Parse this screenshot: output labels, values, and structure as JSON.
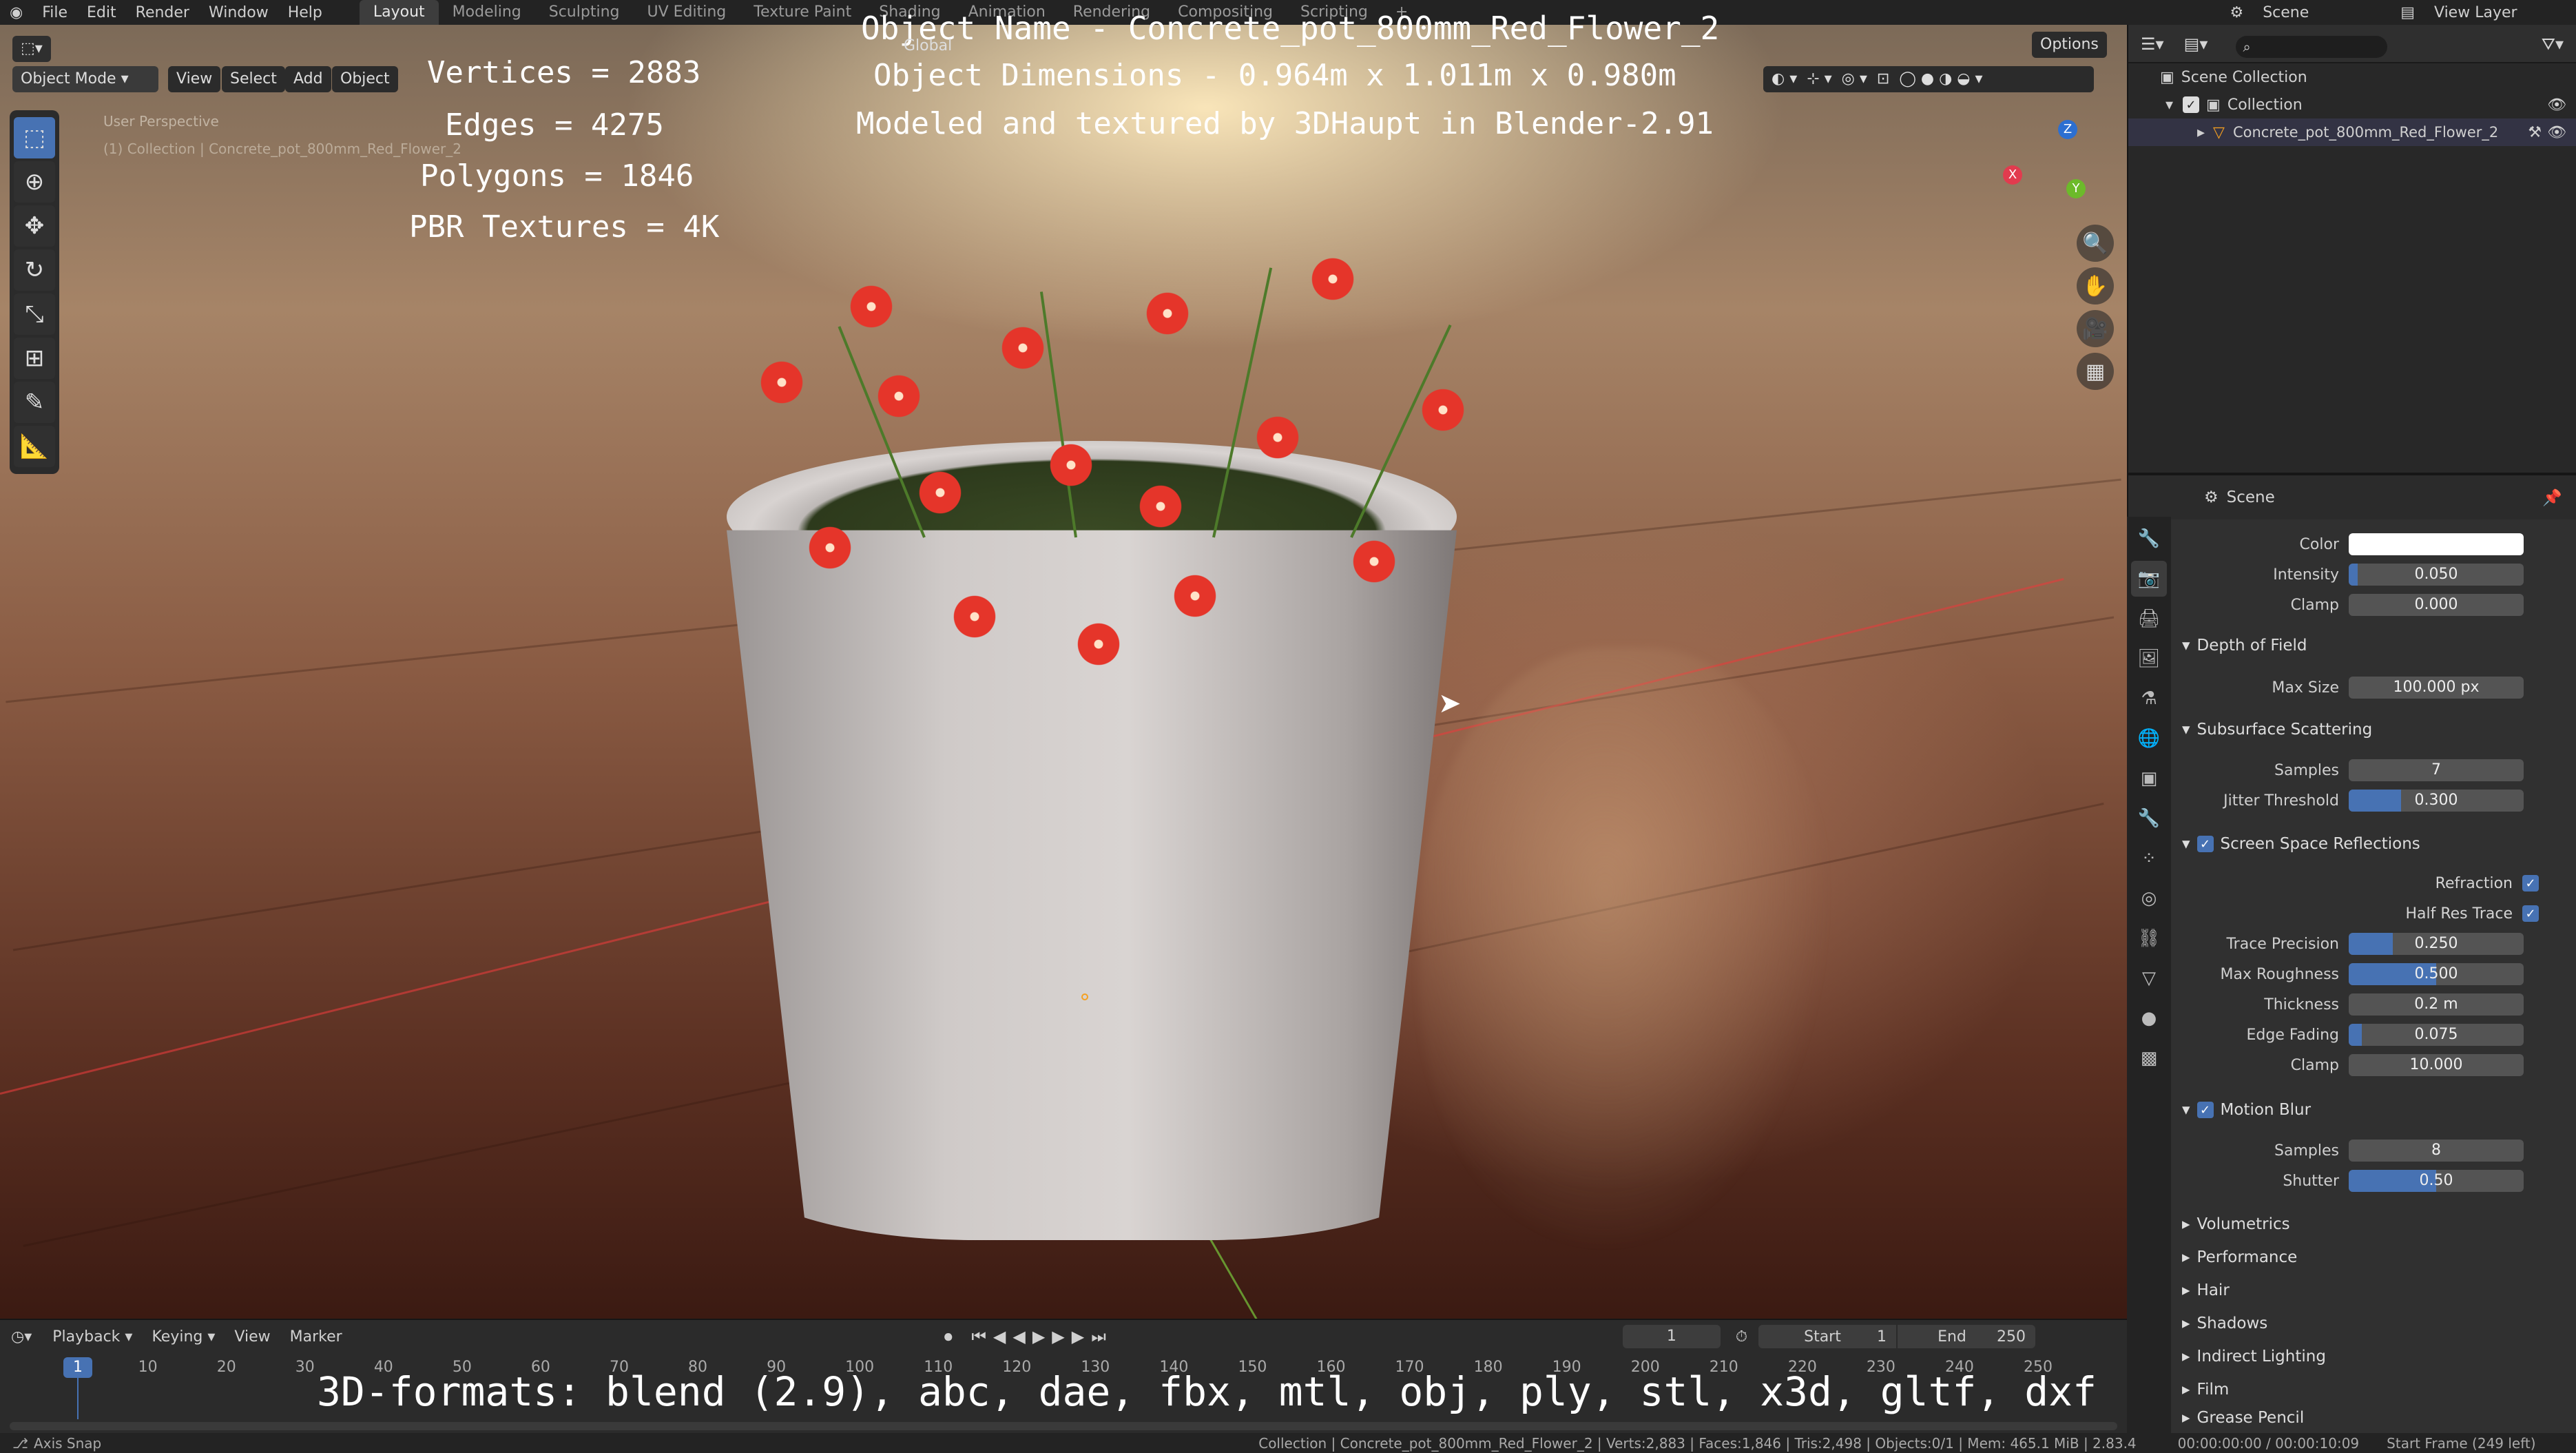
{
  "menu": {
    "items": [
      "File",
      "Edit",
      "Render",
      "Window",
      "Help"
    ]
  },
  "workspaces": [
    "Layout",
    "Modeling",
    "Sculpting",
    "UV Editing",
    "Texture Paint",
    "Shading",
    "Animation",
    "Rendering",
    "Compositing",
    "Scripting"
  ],
  "top_right": {
    "scene": "Scene",
    "view_layer": "View Layer"
  },
  "viewport_header": {
    "mode": "Object Mode",
    "view": "View",
    "select": "Select",
    "add": "Add",
    "object": "Object",
    "orientation": "Global",
    "options": "Options"
  },
  "viewport_info": {
    "perspective": "User Perspective",
    "collection": "(1) Collection | Concrete_pot_800mm_Red_Flower_2"
  },
  "overlay": {
    "object_name": "Object Name - Concrete_pot_800mm_Red_Flower_2",
    "dimensions": "Object Dimensions -  0.964m x 1.011m x 0.980m",
    "credit": "Modeled and textured by 3DHaupt in Blender-2.91",
    "vertices": "Vertices = 2883",
    "edges": "Edges = 4275",
    "polygons": "Polygons = 1846",
    "textures": "PBR Textures = 4K",
    "formats": "3D-formats: blend (2.9), abc, dae, fbx, mtl, obj, ply, stl, x3d, gltf, dxf"
  },
  "outliner": {
    "root": "Scene Collection",
    "collection": "Collection",
    "object": "Concrete_pot_800mm_Red_Flower_2"
  },
  "properties": {
    "context": "Scene",
    "color_label": "Color",
    "intensity": {
      "label": "Intensity",
      "value": "0.050",
      "fill": 0.05
    },
    "clamp_top": {
      "label": "Clamp",
      "value": "0.000"
    },
    "dof": {
      "title": "Depth of Field",
      "max_size_label": "Max Size",
      "max_size": "100.000 px"
    },
    "sss": {
      "title": "Subsurface Scattering",
      "samples_label": "Samples",
      "samples": "7",
      "jitter_label": "Jitter Threshold",
      "jitter": "0.300",
      "jitter_fill": 0.3
    },
    "ssr": {
      "title": "Screen Space Reflections",
      "refraction": "Refraction",
      "half_res": "Half Res Trace",
      "trace_precision_label": "Trace Precision",
      "trace_precision": "0.250",
      "trace_precision_fill": 0.25,
      "max_roughness_label": "Max Roughness",
      "max_roughness": "0.500",
      "max_roughness_fill": 0.5,
      "thickness_label": "Thickness",
      "thickness": "0.2 m",
      "edge_fading_label": "Edge Fading",
      "edge_fading": "0.075",
      "edge_fading_fill": 0.075,
      "clamp_label": "Clamp",
      "clamp": "10.000"
    },
    "motion_blur": {
      "title": "Motion Blur",
      "samples_label": "Samples",
      "samples": "8",
      "shutter_label": "Shutter",
      "shutter": "0.50",
      "shutter_fill": 0.5
    },
    "collapsed": [
      "Volumetrics",
      "Performance",
      "Hair",
      "Shadows",
      "Indirect Lighting",
      "Film",
      "Grease Pencil"
    ]
  },
  "timeline": {
    "playback": "Playback",
    "keying": "Keying",
    "view": "View",
    "marker": "Marker",
    "current_frame": "1",
    "start_label": "Start",
    "start": "1",
    "end_label": "End",
    "end": "250",
    "ticks": [
      "1",
      "10",
      "20",
      "30",
      "40",
      "50",
      "60",
      "70",
      "80",
      "90",
      "100",
      "110",
      "120",
      "130",
      "140",
      "150",
      "160",
      "170",
      "180",
      "190",
      "200",
      "210",
      "220",
      "230",
      "240",
      "250"
    ]
  },
  "statusbar": {
    "left": "Axis Snap",
    "stats": "Collection | Concrete_pot_800mm_Red_Flower_2 | Verts:2,883 | Faces:1,846 | Tris:2,498 | Objects:0/1 | Mem: 465.1 MiB | 2.83.4",
    "time": "00:00:00:00 / 00:00:10:09",
    "start_frame": "Start Frame (249 left)"
  }
}
